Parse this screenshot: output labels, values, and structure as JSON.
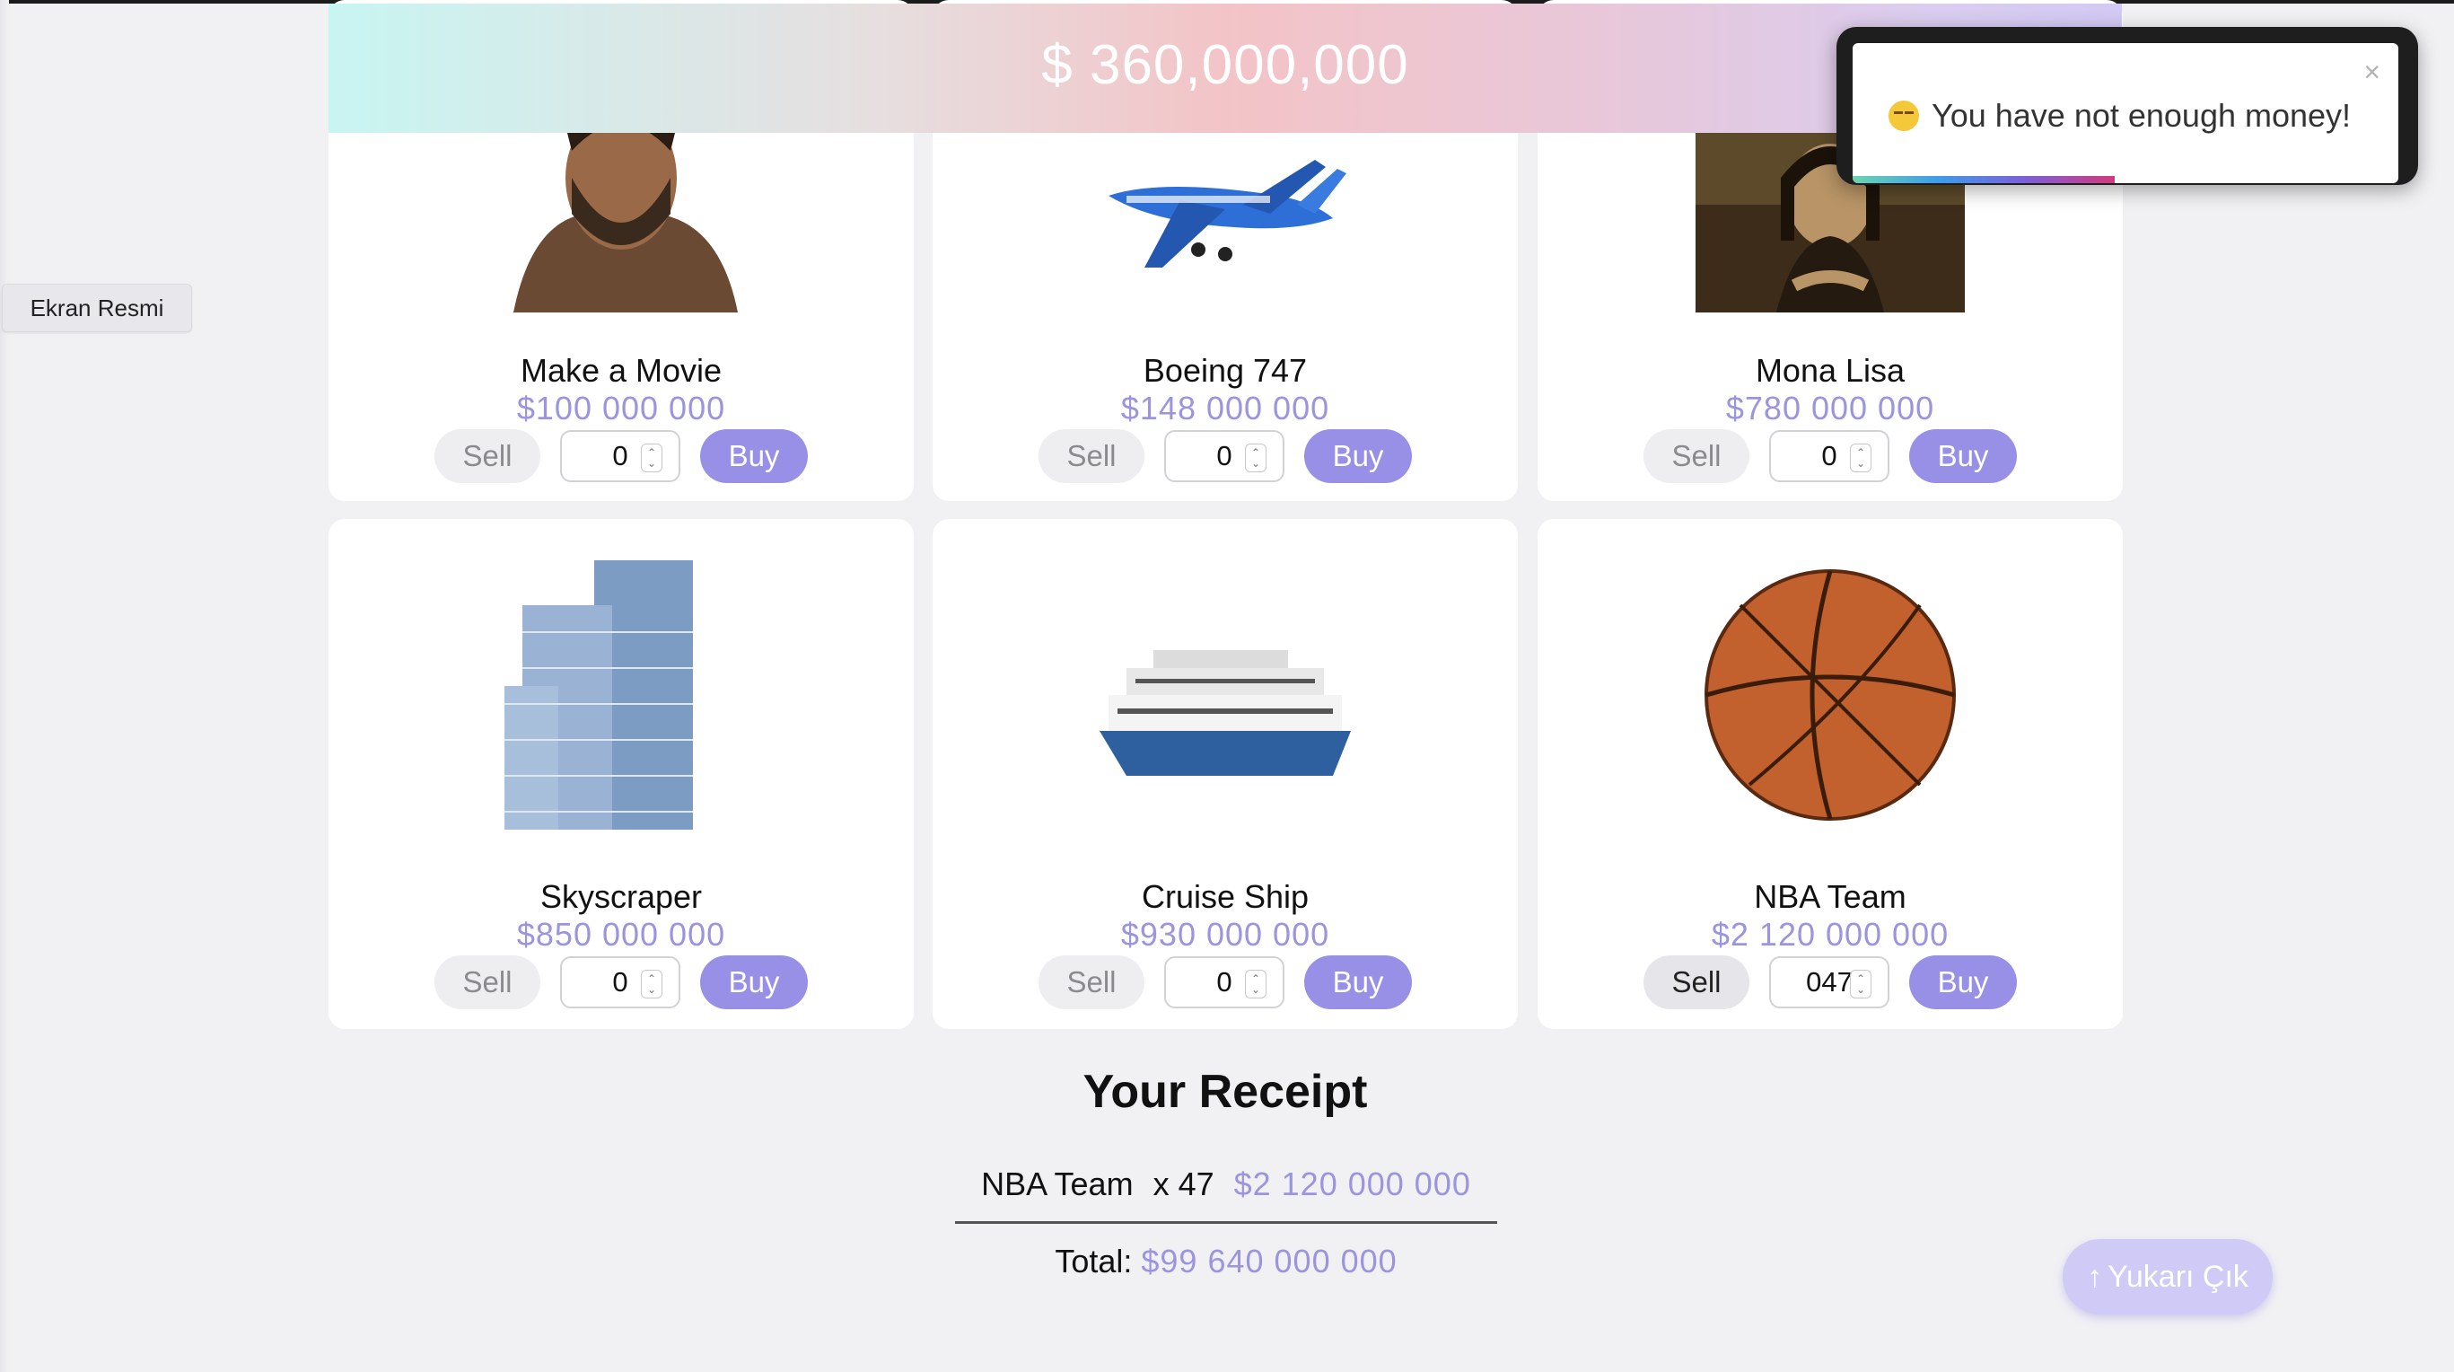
{
  "balance": "$ 360,000,000",
  "toast": {
    "message": "You have not enough money!",
    "close": "×",
    "icon": "pensive-emoji",
    "progress": 0.48
  },
  "screenshot_tag": "Ekran Resmi",
  "labels": {
    "sell": "Sell",
    "buy": "Buy"
  },
  "products": [
    {
      "name": "Make a Movie",
      "price": "$100 000 000",
      "qty": "0",
      "image": "actor-photo"
    },
    {
      "name": "Boeing 747",
      "price": "$148 000 000",
      "qty": "0",
      "image": "airplane-photo"
    },
    {
      "name": "Mona Lisa",
      "price": "$780 000 000",
      "qty": "0",
      "image": "painting-photo"
    },
    {
      "name": "Skyscraper",
      "price": "$850 000 000",
      "qty": "0",
      "image": "skyscraper-photo"
    },
    {
      "name": "Cruise Ship",
      "price": "$930 000 000",
      "qty": "0",
      "image": "cruise-ship-photo"
    },
    {
      "name": "NBA Team",
      "price": "$2 120 000 000",
      "qty": "047",
      "image": "basketball-photo"
    }
  ],
  "receipt": {
    "title": "Your Receipt",
    "items": [
      {
        "name": "NBA Team",
        "qty_label": "x 47",
        "price": "$2 120 000 000"
      }
    ],
    "total_label": "Total:",
    "total": "$99 640 000 000"
  },
  "scroll_top": {
    "icon": "arrow-up-icon",
    "label": "Yukarı Çık"
  },
  "colors": {
    "accent": "#9790e6",
    "price": "#9b94de"
  }
}
